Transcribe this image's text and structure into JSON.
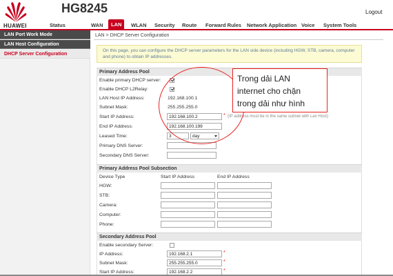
{
  "header": {
    "brand": "HUAWEI",
    "model": "HG8245",
    "logout": "Logout",
    "nav": [
      "Status",
      "WAN",
      "LAN",
      "WLAN",
      "Security",
      "Route",
      "Forward Rules",
      "Network Application",
      "Voice",
      "System Tools"
    ],
    "active_nav": "LAN",
    "accent": "#c8001e"
  },
  "sidebar": {
    "items": [
      "LAN Port Work Mode",
      "LAN Host Configuration",
      "DHCP Server Configuration"
    ],
    "selected": "DHCP Server Configuration"
  },
  "breadcrumb": "LAN > DHCP Server Configuration",
  "notice": "On this page, you can configure the DHCP server parameters for the LAN side device (including HGW, STB, camera, computer and phone) to obtain IP addresses.",
  "primary": {
    "title": "Primary Address Pool",
    "enable_primary_label": "Enable primary DHCP server:",
    "enable_primary_checked": true,
    "enable_l2relay_label": "Enable DHCP L2Relay:",
    "enable_l2relay_checked": true,
    "lan_host_ip_label": "LAN Host IP Address:",
    "lan_host_ip_value": "192.168.100.1",
    "subnet_label": "Subnet Mask:",
    "subnet_value": "255.255.255.0",
    "start_ip_label": "Start IP Address:",
    "start_ip_value": "192.168.100.2",
    "start_ip_hint": "(IP address must be in the same subnet with Lan Host)",
    "end_ip_label": "End IP Address:",
    "end_ip_value": "192.168.100.199",
    "lease_label": "Leased Time:",
    "lease_value": "3",
    "lease_unit": "day",
    "dns1_label": "Primary DNS Server:",
    "dns1_value": "",
    "dns2_label": "Secondary DNS Server:",
    "dns2_value": ""
  },
  "subsection": {
    "title": "Primary Address Pool Subsection",
    "col_device": "Device Type",
    "col_start": "Start IP Address",
    "col_end": "End IP Address",
    "devices": [
      "HGW:",
      "STB:",
      "Camera:",
      "Computer:",
      "Phone:"
    ]
  },
  "secondary": {
    "title": "Secondary Address Pool",
    "enable_label": "Enable secondary Server:",
    "enable_checked": false,
    "ip_label": "IP Address:",
    "ip_value": "192.168.2.1",
    "subnet_label": "Subnet Mask:",
    "subnet_value": "255.255.255.0",
    "start_label": "Start IP Address:",
    "start_value": "192.168.2.2"
  },
  "annotation": {
    "lines": [
      "Trong dải LAN",
      "internet cho chặn",
      "trong dải như hình"
    ],
    "color": "#e8201e"
  }
}
